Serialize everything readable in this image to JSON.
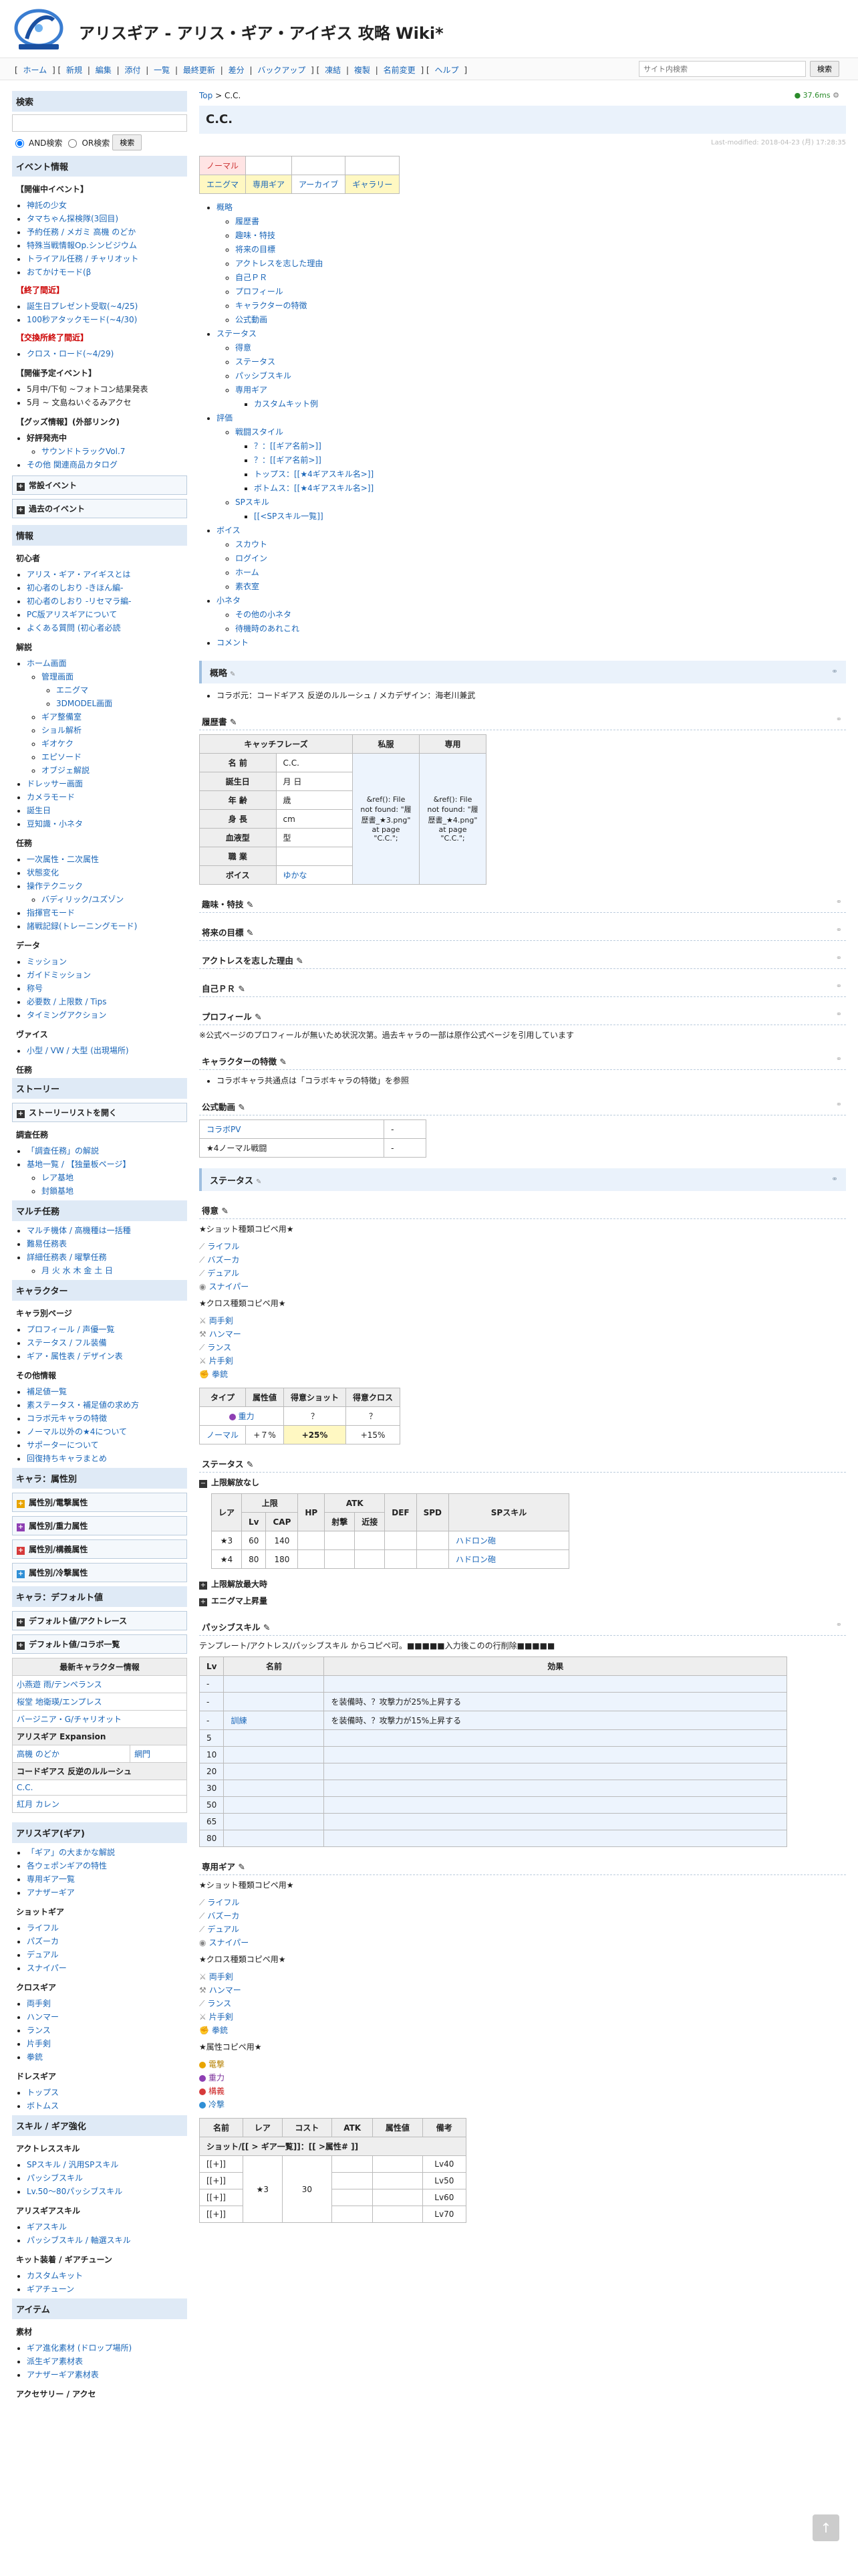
{
  "site": {
    "title": "アリスギア - アリス・ギア・アイギス 攻略 Wiki*"
  },
  "nav": {
    "links": [
      "[",
      "ホーム",
      "] [",
      "新規",
      "|",
      "編集",
      "|",
      "添付",
      "|",
      "一覧",
      "|",
      "最終更新",
      "|",
      "差分",
      "|",
      "バックアップ",
      "] [",
      "凍結",
      "|",
      "複製",
      "|",
      "名前変更",
      "] [",
      "ヘルプ",
      "]"
    ],
    "search_placeholder": "サイト内検索",
    "search_button": "検索"
  },
  "sidebar": {
    "search_heading": "検索",
    "and_label": "AND検索",
    "or_label": "OR検索",
    "search_button": "検索",
    "event_heading": "イベント情報",
    "current_events_heading": "【開催中イベント】",
    "current_events": [
      "神託の少女",
      "タマちゃん探検隊(3回目)",
      "予約任務 / メガミ 高機 のどか",
      "特殊当戦情報Op.シンビジウム",
      "トライアル任務 / チャリオット",
      "おてかけモード(β"
    ],
    "ended_heading": "【終了間近】",
    "ended_events": [
      "誕生日プレゼント受取(~4/25)",
      "100秒アタックモード(~4/30)"
    ],
    "exchange_heading": "【交換所終了間近】",
    "exchange_events": [
      "クロス・ロード(~4/29)"
    ],
    "planned_heading": "【開催予定イベント】",
    "planned_events": [
      "5月中/下旬 ~フォトコン結果発表",
      "5月 ~ 文島ねいぐるみアクセ"
    ],
    "goods_heading": "【グッズ情報】(外部リンク)",
    "goods_sub": "好評発売中",
    "goods_items": [
      "サウンドトラックVol.7",
      "その他 関連商品カタログ"
    ],
    "folds": [
      "常設イベント",
      "過去のイベント"
    ],
    "info_heading": "情報",
    "beginner_heading": "初心者",
    "beginner_items": [
      "アリス・ギア・アイギスとは",
      "初心者のしおり -きほん編-",
      "初心者のしおり -リセマラ編-",
      "PC版アリスギアについて",
      "よくある質問 (初心者必読"
    ],
    "explain_heading": "解説",
    "explain_items": [
      "ホーム画面",
      "管理画面",
      "エニグマ",
      "3DMODEL画面",
      "ギア整備室",
      "ショル解析",
      "ギオケク",
      "エピソード",
      "オブジェ解説",
      "ドレッサー画面",
      "カメラモード",
      "誕生日",
      "豆知識・小ネタ"
    ],
    "battle_heading": "任務",
    "battle_items": [
      "一次属性・二次属性",
      "状態変化",
      "操作テクニック",
      "バディリック/ユズゾン",
      "指揮官モード",
      "諸戦記録(トレーニングモード)"
    ],
    "data_heading": "データ",
    "data_items": [
      "ミッション",
      "ガイドミッション",
      "称号",
      "必要数 / 上限数 / Tips",
      "タイミングアクション"
    ],
    "vaisu_heading": "ヴァイス",
    "vaisu_items": [
      "小型 / VW / 大型 (出現場所)"
    ],
    "mission_heading": "任務",
    "story_heading": "ストーリー",
    "story_fold": "ストーリーリストを開く",
    "survey_heading": "調査任務",
    "survey_items": [
      "「調査任務」の解説",
      "基地一覧 / 【独量板ページ】",
      "レア基地",
      "封鎖基地"
    ],
    "multi_heading": "マルチ任務",
    "multi_items": [
      "マルチ機体 / 高機種は一括種",
      "難易任務表",
      "詳細任務表 / 曜撃任務",
      "月 火 水 木 金 土 日"
    ],
    "char_heading": "キャラクター",
    "char_pages_heading": "キャラ別ページ",
    "char_items": [
      "プロフィール / 声優一覧",
      "ステータス / フル装備",
      "ギア・属性表 / デザイン表"
    ],
    "other_heading": "その他情報",
    "other_items": [
      "補足値一覧",
      "素ステータス・補足値の求め方",
      "コラボ元キャラの特徴",
      "ノーマル以外の★4について",
      "サポーターについて",
      "回復持ちキャラまとめ"
    ],
    "attr_heading": "キャラ：属性別",
    "attr_folds": [
      "属性別/電撃属性",
      "属性別/重力属性",
      "属性別/構義属性",
      "属性別/冷撃属性"
    ],
    "default_heading": "キャラ：デフォルト値",
    "default_folds": [
      "デフォルト値/アクトレース",
      "デフォルト値/コラボ一覧"
    ],
    "latest_heading": "最新キャラクター情報",
    "latest_rows": [
      "小燕遊 雨/テンペランス",
      "桜堂 地衛瑛/エンプレス",
      "バージニア・G/チャリオット"
    ],
    "expansion_heading": "アリスギア Expansion",
    "expansion_rows": [
      [
        "高機 のどか",
        "網門"
      ]
    ],
    "collab_heading": "コードギアス 反逆のルルーシュ",
    "collab_rows": [
      "C.C.",
      "紅月 カレン"
    ],
    "gear_heading": "アリスギア(ギア)",
    "gear_items": [
      "「ギア」の大まかな解説",
      "各ウェポンギアの特性",
      "専用ギア一覧",
      "アナザーギア"
    ],
    "shot_heading": "ショットギア",
    "shot_items": [
      "ライフル",
      "パズーカ",
      "デュアル",
      "スナイパー"
    ],
    "cross_heading": "クロスギア",
    "cross_items": [
      "両手剣",
      "ハンマー",
      "ランス",
      "片手剣",
      "拳銃"
    ],
    "dress_heading": "ドレスギア",
    "dress_items": [
      "トップス",
      "ボトムス"
    ],
    "skill_heading": "スキル / ギア強化",
    "act_skill_heading": "アクトレススキル",
    "act_skill_items": [
      "SPスキル / 汎用SPスキル",
      "パッシブスキル",
      "Lv.50～80パッシブスキル"
    ],
    "alice_skill_heading": "アリスギアスキル",
    "alice_skill_items": [
      "ギアスキル",
      "パッシブスキル / 軸選スキル"
    ],
    "kit_heading": "キット装着 / ギアチューン",
    "kit_items": [
      "カスタムキット",
      "ギアチューン"
    ],
    "item_heading": "アイテム",
    "material_heading": "素材",
    "material_items": [
      "ギア進化素材 (ドロップ場所)",
      "派生ギア素材表",
      "アナザーギア素材表"
    ],
    "ap_heading": "アクセサリー / アクセ"
  },
  "main": {
    "breadcrumb": {
      "top": "Top",
      "sep": " > ",
      "current": "C.C."
    },
    "view_count": "37.6ms",
    "page_title": "C.C.",
    "last_modified": "Last-modified: 2018-04-23 (月) 17:28:35",
    "tag_table": [
      [
        "ノーマル",
        "",
        "",
        ""
      ],
      [
        "エニグマ",
        "専用ギア",
        "アーカイブ",
        "ギャラリー"
      ]
    ],
    "toc": {
      "items": [
        {
          "label": "概略",
          "children": [
            {
              "label": "履歴書"
            },
            {
              "label": "趣味・特技"
            },
            {
              "label": "将来の目標"
            },
            {
              "label": "アクトレスを志した理由"
            },
            {
              "label": "自己ＰＲ"
            },
            {
              "label": "プロフィール"
            },
            {
              "label": "キャラクターの特徴"
            },
            {
              "label": "公式動画"
            }
          ]
        },
        {
          "label": "ステータス",
          "children": [
            {
              "label": "得意"
            },
            {
              "label": "ステータス"
            },
            {
              "label": "パッシブスキル"
            },
            {
              "label": "専用ギア",
              "children": [
                "カスタムキット例"
              ]
            }
          ]
        },
        {
          "label": "評価",
          "children": [
            {
              "label": "戦闘スタイル",
              "children": [
                "？：[[ギア名前>]]",
                "？：[[ギア名前>]]",
                "トップス：[[★4ギアスキル名>]]",
                "ボトムス：[[★4ギアスキル名>]]"
              ]
            },
            {
              "label": "SPスキル",
              "children": [
                "[[<SPスキル一覧]]"
              ]
            }
          ]
        },
        {
          "label": "ボイス",
          "children": [
            {
              "label": "スカウト"
            },
            {
              "label": "ログイン"
            },
            {
              "label": "ホーム"
            },
            {
              "label": "素衣室"
            }
          ]
        },
        {
          "label": "小ネタ",
          "children": [
            {
              "label": "その他の小ネタ"
            },
            {
              "label": "待機時のあれこれ"
            }
          ]
        },
        {
          "label": "コメント",
          "children": []
        }
      ]
    },
    "sec_overview": "概略",
    "overview_text": "コラボ元：コードギアス 反逆のルルーシュ / メカデザイン：海老川兼武",
    "sub_resume": "履歴書",
    "resume": {
      "headers": [
        "キャッチフレーズ",
        "私服",
        "専用"
      ],
      "rows": [
        [
          "名 前",
          "C.C."
        ],
        [
          "誕生日",
          "月 日"
        ],
        [
          "年 齢",
          "歳"
        ],
        [
          "身 長",
          "cm"
        ],
        [
          "血液型",
          "型"
        ],
        [
          "職 業",
          ""
        ],
        [
          "ボイス",
          "ゆかな"
        ]
      ],
      "img1": "&ref(): File not found: \"履歴書_★3.png\" at page \"C.C.\";",
      "img2": "&ref(): File not found: \"履歴書_★4.png\" at page \"C.C.\";"
    },
    "sub_hobby": "趣味・特技",
    "sub_goal": "将来の目標",
    "sub_reason": "アクトレスを志した理由",
    "sub_pr": "自己ＰＲ",
    "sub_profile": "プロフィール",
    "profile_text": "※公式ページのプロフィールが無いため状況次第。過去キャラの一部は原作公式ページを引用しています",
    "sub_feature": "キャラクターの特徴",
    "feature_text": "コラボキャラ共通点は「コラボキャラの特徴」を参照",
    "sub_video": "公式動画",
    "video_rows": [
      [
        "コラボPV",
        "-"
      ],
      [
        "★4ノーマル戦闘",
        "-"
      ]
    ],
    "sec_status": "ステータス",
    "sub_good": "得意",
    "shot_label": "★ショット種類コピペ用★",
    "shot_items": [
      "ライフル",
      "バズーカ",
      "デュアル",
      "スナイパー"
    ],
    "cross_label": "★クロス種類コピペ用★",
    "cross_items": [
      "両手剣",
      "ハンマー",
      "ランス",
      "片手剣",
      "拳銃"
    ],
    "type_table": {
      "headers": [
        "タイプ",
        "属性値",
        "得意ショット",
        "得意クロス"
      ],
      "rows": [
        [
          "重力",
          "",
          "？",
          "？"
        ],
        [
          "ノーマル",
          "+７%",
          "+25%",
          "+15%"
        ]
      ]
    },
    "sub_status": "ステータス",
    "limit_fold": "上限解放なし",
    "stat_table": {
      "headers": [
        "レア",
        "上限",
        "HP",
        "ATK",
        "DEF",
        "SPD",
        "SPスキル"
      ],
      "sub_headers": [
        "Lv",
        "CAP",
        "射撃",
        "近接"
      ],
      "rows": [
        [
          "★3",
          "60",
          "140",
          "",
          "",
          "",
          "",
          "ハドロン砲"
        ],
        [
          "★4",
          "80",
          "180",
          "",
          "",
          "",
          "",
          "ハドロン砲"
        ]
      ]
    },
    "fold_limit_release": "上限解放最大時",
    "fold_enigma": "エニグマ上昇量",
    "sub_passive": "パッシブスキル",
    "passive_intro": "テンプレート/アクトレス/パッシブスキル からコピペ可。■■■■■入力後このの行削除■■■■■",
    "passive_table": {
      "headers": [
        "Lv",
        "名前",
        "効果"
      ],
      "rows": [
        [
          "-",
          "",
          ""
        ],
        [
          "-",
          "",
          "を装備時、？攻撃力が25%上昇する"
        ],
        [
          "-",
          "訓練",
          "を装備時、？攻撃力が15%上昇する"
        ],
        [
          "5",
          "",
          ""
        ],
        [
          "10",
          "",
          ""
        ],
        [
          "20",
          "",
          ""
        ],
        [
          "30",
          "",
          ""
        ],
        [
          "50",
          "",
          ""
        ],
        [
          "65",
          "",
          ""
        ],
        [
          "80",
          "",
          ""
        ]
      ]
    },
    "sub_gear": "専用ギア",
    "attr_label": "★属性コピペ用★",
    "attr_items": [
      "電撃",
      "重力",
      "構義",
      "冷撃"
    ],
    "gear_table": {
      "headers": [
        "名前",
        "レア",
        "コスト",
        "ATK",
        "属性値",
        "備考"
      ],
      "row0": "ショット/[[ > ギア一覧]]：[[ >属性# ]]",
      "rows": [
        [
          "[[+]]",
          "",
          "",
          "",
          "",
          "Lv40"
        ],
        [
          "[[+]]",
          "★3",
          "30",
          "",
          "",
          "Lv50"
        ],
        [
          "[[+]]",
          "",
          "",
          "",
          "",
          "Lv60"
        ],
        [
          "[[+]]",
          "",
          "",
          "",
          "",
          "Lv70"
        ]
      ]
    }
  }
}
